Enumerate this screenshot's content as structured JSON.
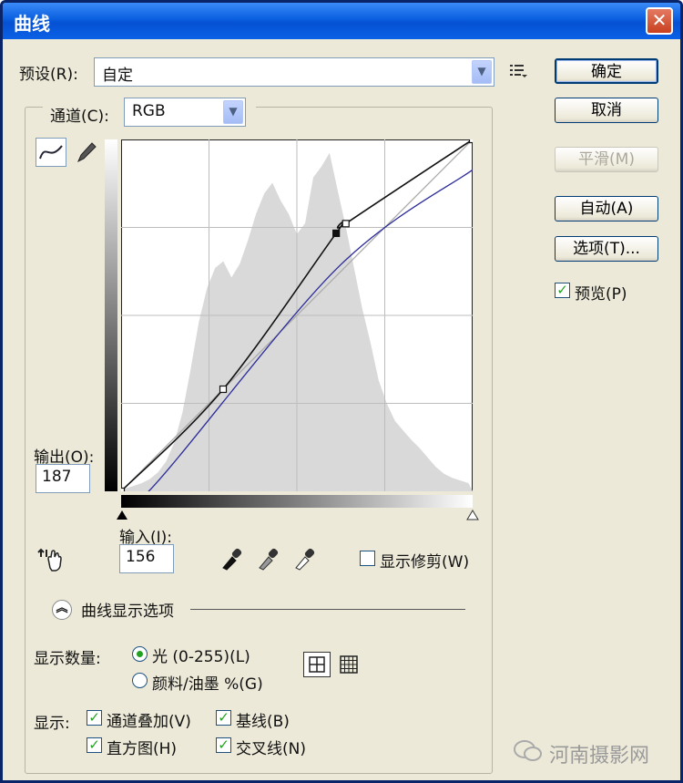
{
  "window": {
    "title": "曲线",
    "close_glyph": "✕"
  },
  "preset": {
    "label": "预设(R):",
    "value": "自定",
    "menu_icon": "preset-options-icon"
  },
  "channel": {
    "label": "通道(C):",
    "value": "RGB"
  },
  "buttons": {
    "ok": "确定",
    "cancel": "取消",
    "smooth": "平滑(M)",
    "auto": "自动(A)",
    "options": "选项(T)..."
  },
  "preview": {
    "label": "预览(P)",
    "checked": true
  },
  "output": {
    "label": "输出(O):",
    "value": "187"
  },
  "input": {
    "label": "输入(I):",
    "value": "156"
  },
  "show_clipping": {
    "label": "显示修剪(W)",
    "checked": false
  },
  "curve_display_options": {
    "label": "曲线显示选项"
  },
  "show_amount": {
    "label": "显示数量:",
    "light_option": "光 (0-255)(L)",
    "pigment_option": "颜料/油墨 %(G)",
    "selected": "light"
  },
  "show": {
    "label": "显示:",
    "channel_overlays": "通道叠加(V)",
    "baseline": "基线(B)",
    "histogram": "直方图(H)",
    "intersection_line": "交叉线(N)"
  },
  "watermark": {
    "text": "河南摄影网"
  },
  "chart_data": {
    "type": "line",
    "xlim": [
      0,
      255
    ],
    "ylim": [
      0,
      255
    ],
    "grid": "4x4",
    "series": [
      {
        "points": [
          [
            0,
            0
          ],
          [
            74,
            74
          ],
          [
            156,
            187
          ],
          [
            163,
            194
          ],
          [
            255,
            255
          ]
        ],
        "color": "#111111"
      },
      {
        "points": [
          [
            0,
            0
          ],
          [
            20,
            0
          ],
          [
            156,
            161
          ],
          [
            255,
            233
          ]
        ],
        "color": "#2a2a9a"
      },
      {
        "points": [
          [
            0,
            0
          ],
          [
            255,
            255
          ]
        ],
        "color": "#aaaaaa"
      }
    ],
    "histogram": [
      2,
      4,
      6,
      9,
      14,
      22,
      36,
      58,
      90,
      125,
      150,
      165,
      170,
      158,
      168,
      185,
      205,
      220,
      228,
      215,
      205,
      190,
      198,
      232,
      240,
      250,
      222,
      195,
      165,
      135,
      110,
      82,
      65,
      52,
      45,
      38,
      32,
      25,
      18,
      13,
      10,
      8,
      6
    ]
  }
}
